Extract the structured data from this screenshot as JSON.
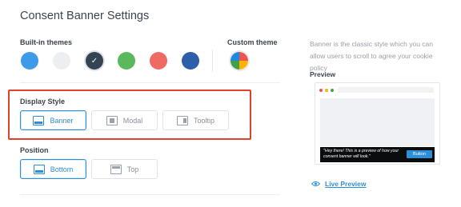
{
  "page": {
    "title": "Consent Banner Settings"
  },
  "themes": {
    "builtin_label": "Built-in themes",
    "custom_label": "Custom theme",
    "swatches": [
      {
        "name": "light-blue",
        "color": "#3d9be9",
        "selected": false
      },
      {
        "name": "light-gray",
        "color": "#eceef1",
        "selected": false
      },
      {
        "name": "dark-slate",
        "color": "#344452",
        "selected": true
      },
      {
        "name": "green",
        "color": "#5cb85c",
        "selected": false
      },
      {
        "name": "salmon",
        "color": "#ef6a63",
        "selected": false
      },
      {
        "name": "navy",
        "color": "#2c5eaa",
        "selected": false
      }
    ],
    "check_icon": "checkmark-icon",
    "custom_icon": "color-wheel-icon"
  },
  "display_style": {
    "label": "Display Style",
    "options": [
      {
        "label": "Banner",
        "icon": "banner-layout-icon",
        "active": true
      },
      {
        "label": "Modal",
        "icon": "modal-layout-icon",
        "active": false
      },
      {
        "label": "Tooltip",
        "icon": "tooltip-layout-icon",
        "active": false
      }
    ]
  },
  "position": {
    "label": "Position",
    "options": [
      {
        "label": "Bottom",
        "icon": "bottom-position-icon",
        "active": true
      },
      {
        "label": "Top",
        "icon": "top-position-icon",
        "active": false
      }
    ]
  },
  "sidebar": {
    "description": "Banner is the classic style which you can allow users to scroll to agree your cookie policy",
    "preview_label": "Preview",
    "preview": {
      "banner_text": "\"Hey there! This is a preview of how your consent banner will look.\"",
      "button_label": "Button",
      "dot_colors": [
        "#ef5350",
        "#ffb300",
        "#43a047"
      ]
    },
    "live_preview_label": "Live Preview",
    "live_preview_icon": "eye-icon"
  },
  "colors": {
    "accent": "#2e8fd8",
    "highlight": "#e2402c"
  }
}
